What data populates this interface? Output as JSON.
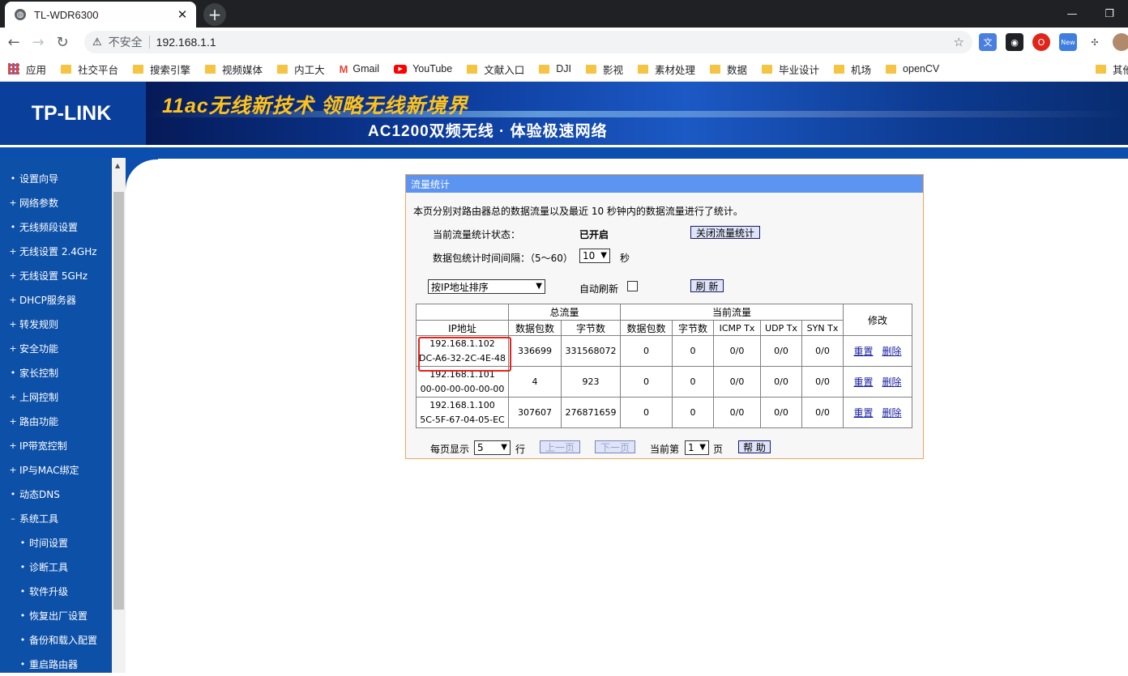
{
  "browser": {
    "tab_title": "TL-WDR6300",
    "new_tab_icon": "+",
    "insecure_label": "不安全",
    "url": "192.168.1.1"
  },
  "bookmarks": [
    {
      "label": "应用",
      "icon": "apps-icon"
    },
    {
      "label": "社交平台",
      "icon": "folder-icon"
    },
    {
      "label": "搜索引擎",
      "icon": "folder-icon"
    },
    {
      "label": "视频媒体",
      "icon": "folder-icon"
    },
    {
      "label": "内工大",
      "icon": "folder-icon"
    },
    {
      "label": "Gmail",
      "icon": "gmail-icon"
    },
    {
      "label": "YouTube",
      "icon": "youtube-icon"
    },
    {
      "label": "文献入口",
      "icon": "folder-icon"
    },
    {
      "label": "DJI",
      "icon": "folder-icon"
    },
    {
      "label": "影视",
      "icon": "folder-icon"
    },
    {
      "label": "素材处理",
      "icon": "folder-icon"
    },
    {
      "label": "数据",
      "icon": "folder-icon"
    },
    {
      "label": "毕业设计",
      "icon": "folder-icon"
    },
    {
      "label": "机场",
      "icon": "folder-icon"
    },
    {
      "label": "openCV",
      "icon": "folder-icon"
    },
    {
      "label": "其他",
      "icon": "folder-icon"
    }
  ],
  "header": {
    "logo": "TP-LINK",
    "slogan_main": "11ac无线新技术 领略无线新境界",
    "slogan_sub": "AC1200双频无线 · 体验极速网络"
  },
  "sidebar": [
    {
      "label": "设置向导",
      "bullet": "•",
      "sub": false
    },
    {
      "label": "网络参数",
      "bullet": "+",
      "sub": false
    },
    {
      "label": "无线频段设置",
      "bullet": "•",
      "sub": false
    },
    {
      "label": "无线设置 2.4GHz",
      "bullet": "+",
      "sub": false
    },
    {
      "label": "无线设置 5GHz",
      "bullet": "+",
      "sub": false
    },
    {
      "label": "DHCP服务器",
      "bullet": "+",
      "sub": false
    },
    {
      "label": "转发规则",
      "bullet": "+",
      "sub": false
    },
    {
      "label": "安全功能",
      "bullet": "+",
      "sub": false
    },
    {
      "label": "家长控制",
      "bullet": "•",
      "sub": false
    },
    {
      "label": "上网控制",
      "bullet": "+",
      "sub": false
    },
    {
      "label": "路由功能",
      "bullet": "+",
      "sub": false
    },
    {
      "label": "IP带宽控制",
      "bullet": "+",
      "sub": false
    },
    {
      "label": "IP与MAC绑定",
      "bullet": "+",
      "sub": false
    },
    {
      "label": "动态DNS",
      "bullet": "•",
      "sub": false
    },
    {
      "label": "系统工具",
      "bullet": "–",
      "sub": false
    },
    {
      "label": "时间设置",
      "bullet": "•",
      "sub": true
    },
    {
      "label": "诊断工具",
      "bullet": "•",
      "sub": true
    },
    {
      "label": "软件升级",
      "bullet": "•",
      "sub": true
    },
    {
      "label": "恢复出厂设置",
      "bullet": "•",
      "sub": true
    },
    {
      "label": "备份和载入配置",
      "bullet": "•",
      "sub": true
    },
    {
      "label": "重启路由器",
      "bullet": "•",
      "sub": true
    }
  ],
  "panel": {
    "title": "流量统计",
    "description": "本页分别对路由器总的数据流量以及最近 10 秒钟内的数据流量进行了统计。",
    "status_label": "当前流量统计状态：",
    "status_value": "已开启",
    "toggle_button": "关闭流量统计",
    "interval_label": "数据包统计时间间隔：（5～60）",
    "interval_value": "10",
    "interval_unit": "秒",
    "sort_value": "按IP地址排序",
    "auto_refresh_label": "自动刷新",
    "refresh_button": "刷 新"
  },
  "table": {
    "group_total": "总流量",
    "group_current": "当前流量",
    "col_modify": "修改",
    "columns": [
      "IP地址",
      "数据包数",
      "字节数",
      "数据包数",
      "字节数",
      "ICMP Tx",
      "UDP Tx",
      "SYN Tx"
    ],
    "rows": [
      {
        "ip": "192.168.1.102",
        "mac": "DC-A6-32-2C-4E-48",
        "total_packets": "336699",
        "total_bytes": "331568072",
        "cur_packets": "0",
        "cur_bytes": "0",
        "icmp": "0/0",
        "udp": "0/0",
        "syn": "0/0",
        "reset": "重置",
        "delete": "删除"
      },
      {
        "ip": "192.168.1.101",
        "mac": "00-00-00-00-00-00",
        "total_packets": "4",
        "total_bytes": "923",
        "cur_packets": "0",
        "cur_bytes": "0",
        "icmp": "0/0",
        "udp": "0/0",
        "syn": "0/0",
        "reset": "重置",
        "delete": "删除"
      },
      {
        "ip": "192.168.1.100",
        "mac": "5C-5F-67-04-05-EC",
        "total_packets": "307607",
        "total_bytes": "276871659",
        "cur_packets": "0",
        "cur_bytes": "0",
        "icmp": "0/0",
        "udp": "0/0",
        "syn": "0/0",
        "reset": "重置",
        "delete": "删除"
      }
    ]
  },
  "pager": {
    "per_page_label": "每页显示",
    "per_page_value": "5",
    "rows_unit": "行",
    "prev_button": "上一页",
    "next_button": "下一页",
    "current_label": "当前第",
    "current_value": "1",
    "page_unit": "页",
    "help_button": "帮 助"
  },
  "colors": {
    "sidebar_bg": "#0d50a8",
    "panel_head": "#5b94f1",
    "panel_border": "#f0a55a",
    "highlight": "#e8211a"
  }
}
